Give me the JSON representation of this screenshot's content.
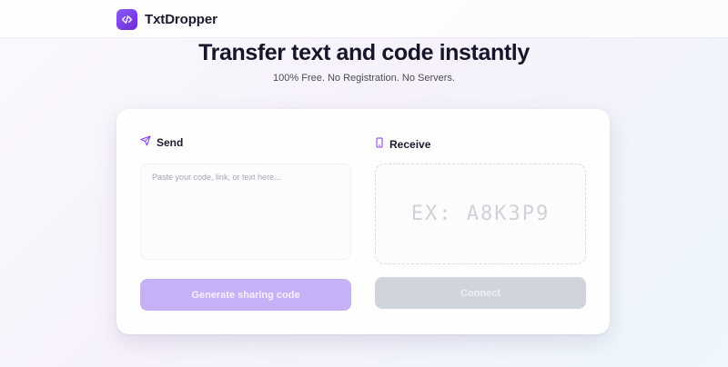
{
  "app": {
    "name": "TxtDropper",
    "accent_color": "#7c3aed",
    "logo_icon": "code-icon"
  },
  "hero": {
    "title": "Transfer text and code instantly",
    "subtitle": "100% Free. No Registration. No Servers."
  },
  "send": {
    "title": "Send",
    "icon": "paper-plane-icon",
    "placeholder": "Paste your code, link, or text here...",
    "value": "",
    "button_label": "Generate sharing code",
    "button_color": "#c6b1f7"
  },
  "receive": {
    "title": "Receive",
    "icon": "smartphone-icon",
    "code_placeholder": "EX: A8K3P9",
    "code_value": "",
    "button_label": "Connect",
    "button_color": "#d0d4dd"
  }
}
